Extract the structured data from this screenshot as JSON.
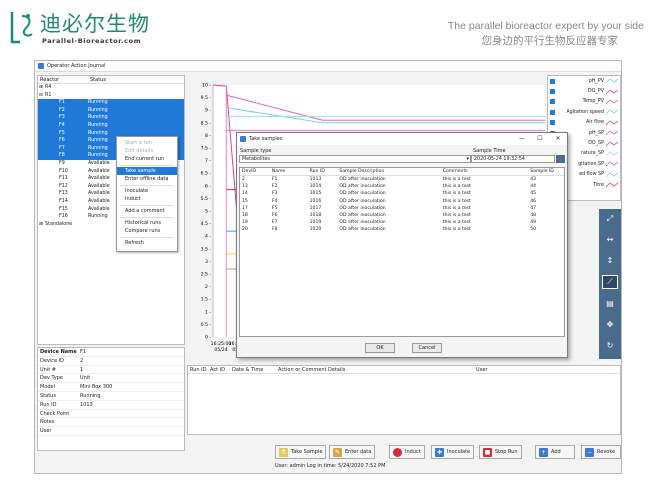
{
  "brand": {
    "name_cn": "迪必尔生物",
    "name_en": "Parallel-Bioreactor.com",
    "tagline_en": "The parallel bioreactor expert  by your side",
    "tagline_cn": "您身边的平行生物反应器专家",
    "accent": "#1f8a70"
  },
  "window": {
    "title": "Operator Action Journal"
  },
  "tree": {
    "headers": [
      "Reactor",
      "Status"
    ],
    "rows": [
      {
        "name": "R4",
        "status": "",
        "indent": 1,
        "expander": "⊞",
        "selected": false
      },
      {
        "name": "R1",
        "status": "",
        "indent": 1,
        "expander": "⊟",
        "selected": false
      },
      {
        "name": "F1",
        "status": "Running",
        "indent": 3,
        "selected": true
      },
      {
        "name": "F2",
        "status": "Running",
        "indent": 3,
        "selected": true
      },
      {
        "name": "F3",
        "status": "Running",
        "indent": 3,
        "selected": true
      },
      {
        "name": "F4",
        "status": "Running",
        "indent": 3,
        "selected": true
      },
      {
        "name": "F5",
        "status": "Running",
        "indent": 3,
        "selected": true
      },
      {
        "name": "F6",
        "status": "Running",
        "indent": 3,
        "selected": true
      },
      {
        "name": "F7",
        "status": "Running",
        "indent": 3,
        "selected": true
      },
      {
        "name": "F8",
        "status": "Running",
        "indent": 3,
        "selected": true
      },
      {
        "name": "F9",
        "status": "Available",
        "indent": 3,
        "selected": false
      },
      {
        "name": "F10",
        "status": "Available",
        "indent": 3,
        "selected": false
      },
      {
        "name": "F11",
        "status": "Available",
        "indent": 3,
        "selected": false
      },
      {
        "name": "F12",
        "status": "Available",
        "indent": 3,
        "selected": false
      },
      {
        "name": "F13",
        "status": "Available",
        "indent": 3,
        "selected": false
      },
      {
        "name": "F14",
        "status": "Available",
        "indent": 3,
        "selected": false
      },
      {
        "name": "F15",
        "status": "Available",
        "indent": 3,
        "selected": false
      },
      {
        "name": "F16",
        "status": "Running",
        "indent": 3,
        "selected": false
      },
      {
        "name": "Standalone",
        "status": "",
        "indent": 1,
        "expander": "⊞",
        "selected": false
      }
    ]
  },
  "context_menu": {
    "items": [
      {
        "label": "Start a run",
        "disabled": true
      },
      {
        "label": "Edit details",
        "disabled": true
      },
      {
        "label": "End current run",
        "disabled": false
      },
      {
        "sep": true
      },
      {
        "label": "Take sample",
        "highlight": true
      },
      {
        "label": "Enter offline data"
      },
      {
        "sep": true
      },
      {
        "label": "Inoculate"
      },
      {
        "label": "Induct"
      },
      {
        "sep": true
      },
      {
        "label": "Add a comment"
      },
      {
        "sep": true
      },
      {
        "label": "Historical runs"
      },
      {
        "label": "Compare runs"
      },
      {
        "sep": true
      },
      {
        "label": "Refresh"
      }
    ]
  },
  "device": {
    "rows": [
      {
        "key": "Device Name",
        "value": "F1",
        "bold": true
      },
      {
        "key": "Device ID",
        "value": "2"
      },
      {
        "key": "Unit #",
        "value": "1"
      },
      {
        "key": "Dev Type",
        "value": "Unit"
      },
      {
        "key": "Model",
        "value": "Mini Box 300"
      },
      {
        "key": "Status",
        "value": "Running"
      },
      {
        "key": "Run ID",
        "value": "1013"
      },
      {
        "key": "Check Point",
        "value": ""
      },
      {
        "key": "Notes",
        "value": ""
      },
      {
        "key": "User",
        "value": ""
      }
    ]
  },
  "chart_data": {
    "type": "line",
    "y_ticks": [
      "0 -",
      "0.5 -",
      "1 -",
      "1.5 -",
      "2 -",
      "2.5 -",
      "3 -",
      "3.5 -",
      "4 -",
      "4.5 -",
      "5 -",
      "5.5 -",
      "6 -",
      "6.5 -",
      "7 -",
      "7.5 -",
      "8 -",
      "8.5 -",
      "9 -",
      "9.5 -",
      "10 -"
    ],
    "x_ticks": [
      {
        "time": "16:25:00",
        "date": "05/24"
      },
      {
        "time": "16:40:00",
        "date": "05/24"
      },
      {
        "time": "16:45:00",
        "date": "05/24"
      },
      {
        "time": "16:",
        "date": "05/"
      }
    ],
    "ylim": [
      0,
      10
    ],
    "series": [
      {
        "color": "#e0409a",
        "points": [
          [
            0,
            10
          ],
          [
            0.04,
            9.95
          ],
          [
            0.1,
            0.5
          ]
        ]
      },
      {
        "color": "#e060c8",
        "points": [
          [
            0.04,
            9.6
          ],
          [
            0.33,
            8.6
          ],
          [
            1,
            8.6
          ]
        ]
      },
      {
        "color": "#7ec8e6",
        "points": [
          [
            0.04,
            9.1
          ],
          [
            0.33,
            8.5
          ],
          [
            1,
            8.5
          ]
        ]
      },
      {
        "color": "#a0e0e8",
        "points": [
          [
            0.04,
            8.75
          ],
          [
            1,
            8.75
          ]
        ]
      },
      {
        "color": "#f07ad0",
        "points": [
          [
            0.04,
            8.2
          ],
          [
            1,
            8.2
          ]
        ]
      },
      {
        "color": "#00aaff",
        "points": [
          [
            0.04,
            4.2
          ],
          [
            0.33,
            4.2
          ]
        ]
      },
      {
        "color": "#ffd24a",
        "points": [
          [
            0.04,
            3.3
          ],
          [
            0.33,
            3.3
          ]
        ]
      },
      {
        "color": "#5cd05c",
        "points": [
          [
            0.04,
            2.7
          ],
          [
            0.33,
            2.7
          ]
        ]
      },
      {
        "color": "#e03030",
        "points": [
          [
            0.04,
            5.85
          ],
          [
            0.07,
            5.85
          ]
        ]
      },
      {
        "color": "#f080c8",
        "points": [
          [
            0.04,
            0
          ],
          [
            0.04,
            10
          ]
        ]
      }
    ]
  },
  "legend": {
    "items": [
      {
        "label": "pH_PV",
        "color": "#7ec8e6"
      },
      {
        "label": "DO_PV",
        "color": "#e0409a"
      },
      {
        "label": "Temp_PV",
        "color": "#e060c8"
      },
      {
        "label": "Agitation speed",
        "color": "#7ec8e6"
      },
      {
        "label": "Air flow",
        "color": "#e0409a"
      },
      {
        "label": "pH_SP",
        "color": "#e060c8"
      },
      {
        "label": "DO_SP",
        "color": "#e0409a"
      },
      {
        "label": "rature_SP",
        "color": "#a0e0e8"
      },
      {
        "label": "gitation SP",
        "color": "#e060c8"
      },
      {
        "label": "ed flow SP",
        "color": "#7ec8e6"
      },
      {
        "label": "Titre",
        "color": "#e0409a"
      }
    ]
  },
  "right_toolbar": {
    "buttons": [
      {
        "icon": "expand-icon",
        "glyph": "⤢"
      },
      {
        "icon": "fit-width-icon",
        "glyph": "↔"
      },
      {
        "icon": "fit-height-icon",
        "glyph": "↕"
      },
      {
        "icon": "chart-line-icon",
        "glyph": "⟋",
        "active": true
      },
      {
        "icon": "table-icon",
        "glyph": "▤"
      },
      {
        "icon": "move-icon",
        "glyph": "✥"
      },
      {
        "icon": "refresh-icon",
        "glyph": "↻"
      }
    ]
  },
  "journal": {
    "headers": [
      "Run ID",
      "Act ID",
      "Date & Time",
      "Action or Comment Details",
      "User"
    ]
  },
  "buttons": {
    "take_sample": "Take Sample",
    "enter_data": "Enter data",
    "induct": "Induct",
    "inoculate": "Inoculate",
    "stop_run": "Stop Run",
    "add": "Add",
    "revoke": "Revoke"
  },
  "status": {
    "text": "User: admin  Log in time: 5/24/2020 7:52 PM"
  },
  "dialog": {
    "title": "Take samples",
    "sample_type_label": "Sample type",
    "sample_type_value": "Metabolites",
    "sample_time_label": "Sample Time",
    "sample_time_value": "2020-05-24 19:32:54",
    "headers": [
      "DevID",
      "Name",
      "Run ID",
      "Sample Description",
      "Comments",
      "Sample ID"
    ],
    "rows": [
      [
        "2",
        "F1",
        "1013",
        "OD after inoculation",
        "this is a test",
        "43"
      ],
      [
        "13",
        "F2",
        "1014",
        "OD after inoculation",
        "this is a test",
        "44"
      ],
      [
        "14",
        "F3",
        "1015",
        "OD after inoculation",
        "this is a test",
        "45"
      ],
      [
        "15",
        "F4",
        "1016",
        "OD after inoculation",
        "this is a test",
        "46"
      ],
      [
        "17",
        "F5",
        "1017",
        "OD after inoculation",
        "this is a test",
        "47"
      ],
      [
        "18",
        "F6",
        "1018",
        "OD after inoculation",
        "this is a test",
        "48"
      ],
      [
        "19",
        "F7",
        "1019",
        "OD after inoculation",
        "this is a test",
        "49"
      ],
      [
        "20",
        "F8",
        "1020",
        "OD after inoculation",
        "this is a test",
        "50"
      ]
    ],
    "ok": "OK",
    "cancel": "Cancel",
    "minimize": "—",
    "maximize": "☐",
    "close": "✕"
  }
}
